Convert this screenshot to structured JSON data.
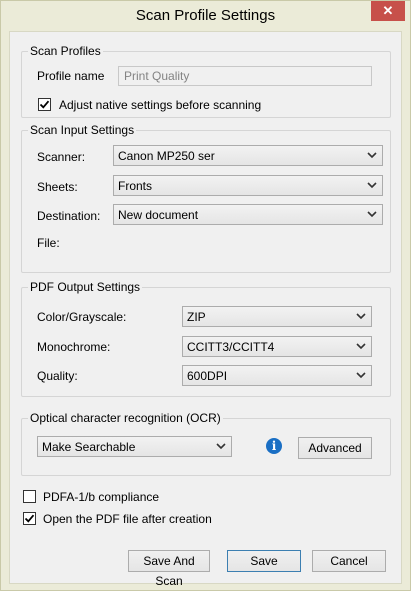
{
  "window": {
    "title": "Scan Profile Settings",
    "close_glyph": "✕"
  },
  "scan_profiles": {
    "legend": "Scan Profiles",
    "profile_name_label": "Profile name",
    "profile_name_value": "Print Quality",
    "adjust_native_label": "Adjust native settings before scanning",
    "adjust_native_checked": true
  },
  "scan_input": {
    "legend": "Scan Input Settings",
    "scanner_label": "Scanner:",
    "scanner_value": "Canon MP250 ser",
    "sheets_label": "Sheets:",
    "sheets_value": "Fronts",
    "destination_label": "Destination:",
    "destination_value": "New document",
    "file_label": "File:"
  },
  "pdf_output": {
    "legend": "PDF Output Settings",
    "color_label": "Color/Grayscale:",
    "color_value": "ZIP",
    "mono_label": "Monochrome:",
    "mono_value": "CCITT3/CCITT4",
    "quality_label": "Quality:",
    "quality_value": "600DPI"
  },
  "ocr": {
    "legend": "Optical character recognition (OCR)",
    "mode_value": "Make Searchable",
    "info_glyph": "i",
    "advanced_label": "Advanced"
  },
  "options": {
    "pdfa_label": "PDFA-1/b compliance",
    "pdfa_checked": false,
    "open_pdf_label": "Open the PDF file after creation",
    "open_pdf_checked": true
  },
  "buttons": {
    "save_and_scan": "Save And Scan",
    "save": "Save",
    "cancel": "Cancel"
  },
  "icons": [
    "close-icon",
    "chevron-down-icon",
    "checkmark-icon",
    "info-icon"
  ]
}
